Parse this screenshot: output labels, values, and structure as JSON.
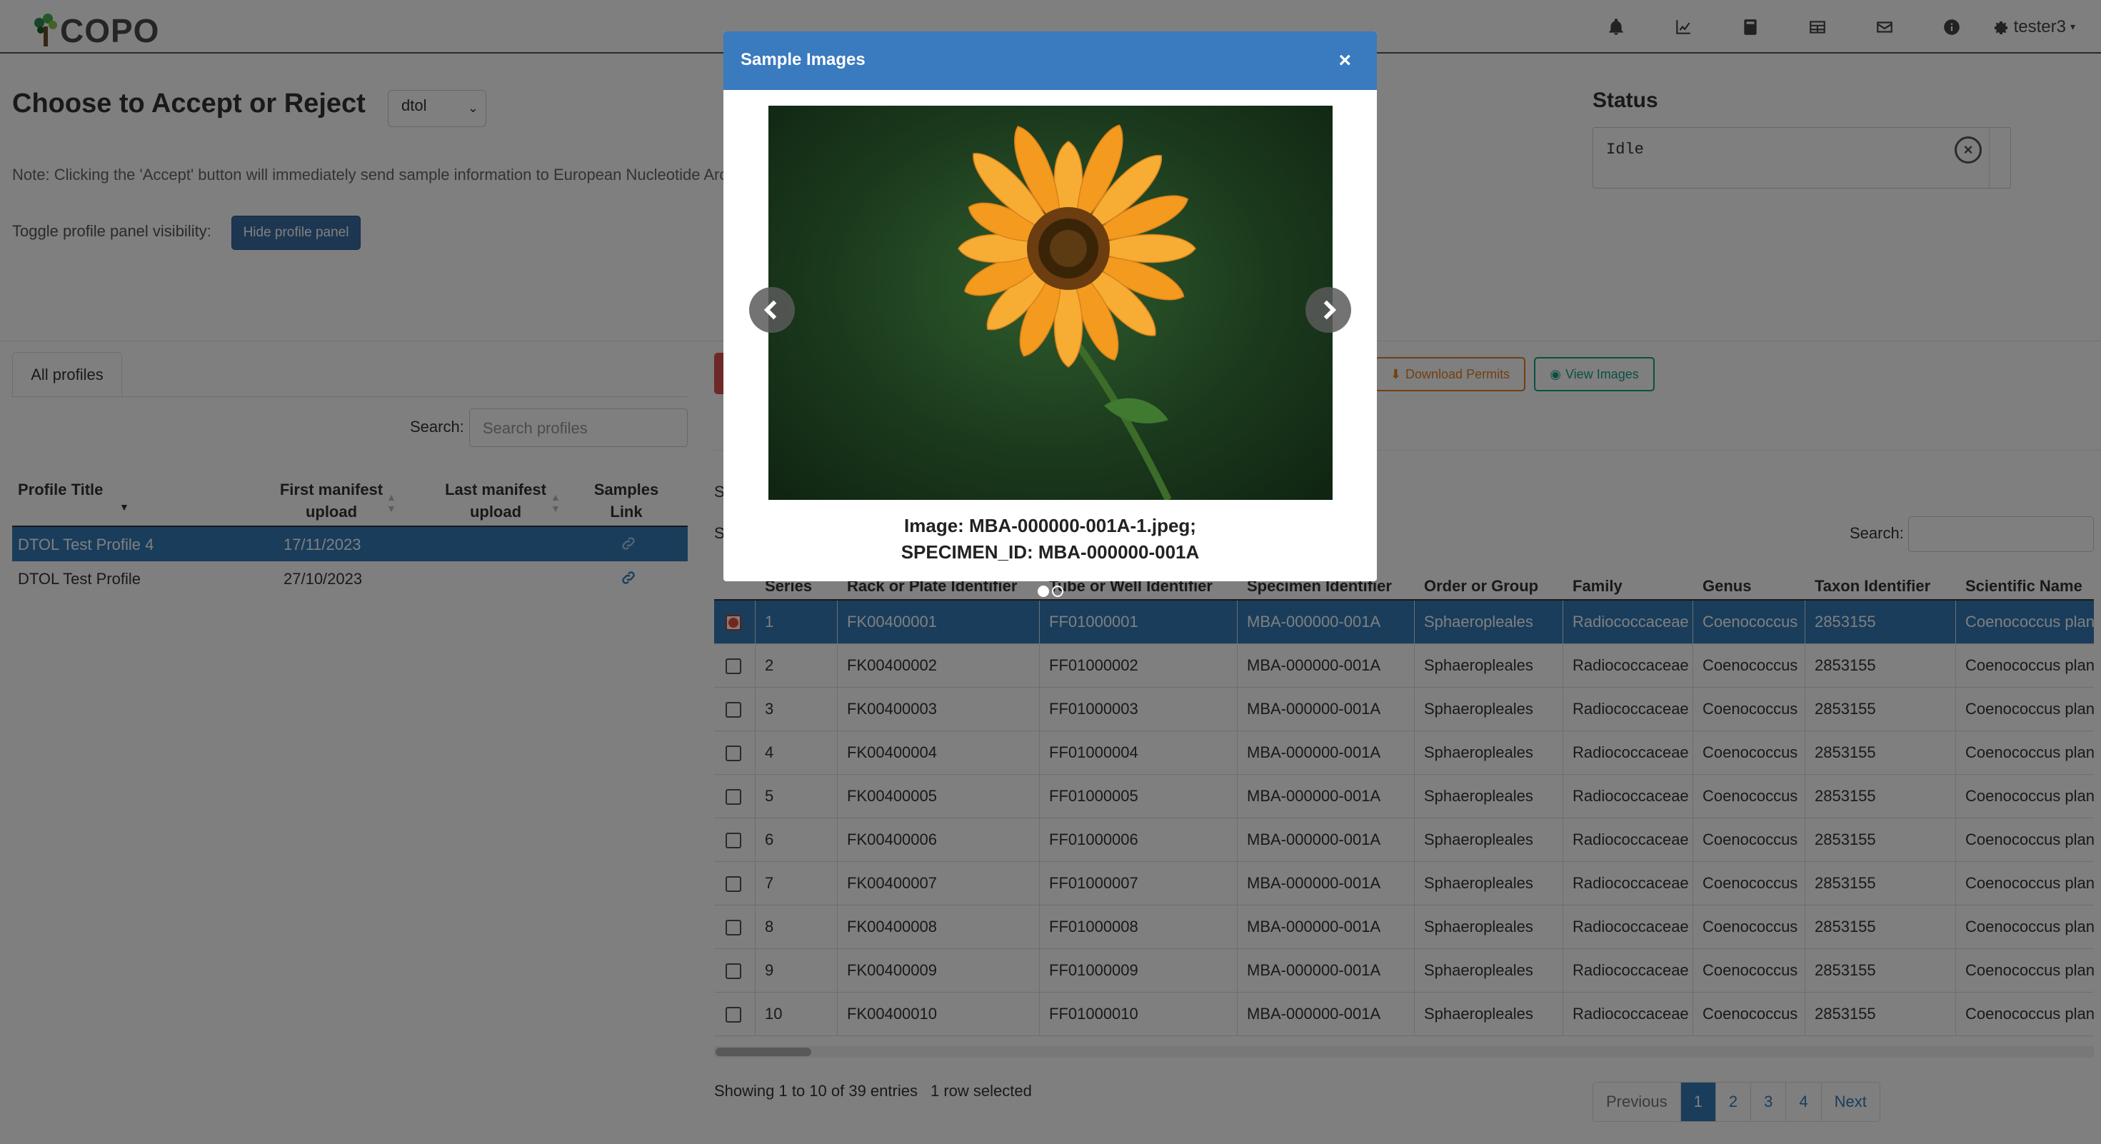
{
  "brand": {
    "logo_text": "COPO"
  },
  "navbar": {
    "icons": [
      "bell-icon",
      "chart-icon",
      "book-icon",
      "table-icon",
      "envelope-icon",
      "info-icon"
    ],
    "user": "tester3"
  },
  "header": {
    "title": "Choose to Accept or Reject",
    "profile_type": "dtol",
    "note": "Note: Clicking the 'Accept' button will immediately send sample information to European Nucleotide Archive (ENA)",
    "toggle_label": "Toggle profile panel visibility:",
    "hide_button": "Hide profile panel"
  },
  "status": {
    "title": "Status",
    "text": "Idle"
  },
  "profiles": {
    "tab": "All profiles",
    "search_label": "Search:",
    "search_placeholder": "Search profiles",
    "columns": [
      "Profile Title",
      "First manifest upload",
      "Last manifest upload",
      "Samples Link"
    ],
    "rows": [
      {
        "title": "DTOL Test Profile 4",
        "first": "17/11/2023",
        "last": "",
        "selected": true
      },
      {
        "title": "DTOL Test Profile",
        "first": "27/10/2023",
        "last": "",
        "selected": false
      }
    ]
  },
  "samples_toolbar": {
    "download_permits": "Download Permits",
    "view_images": "View Images",
    "search_label": "Search:",
    "stub1": "S",
    "stub2": "S"
  },
  "samples": {
    "columns": [
      "",
      "Series",
      "Rack or Plate Identifier",
      "Tube or Well Identifier",
      "Specimen Identifier",
      "Order or Group",
      "Family",
      "Genus",
      "Taxon Identifier",
      "Scientific Name"
    ],
    "rows": [
      [
        "1",
        "FK00400001",
        "FF01000001",
        "MBA-000000-001A",
        "Sphaeropleales",
        "Radiococcaceae",
        "Coenococcus",
        "2853155",
        "Coenococcus planctonicus"
      ],
      [
        "2",
        "FK00400002",
        "FF01000002",
        "MBA-000000-001A",
        "Sphaeropleales",
        "Radiococcaceae",
        "Coenococcus",
        "2853155",
        "Coenococcus planctonicus"
      ],
      [
        "3",
        "FK00400003",
        "FF01000003",
        "MBA-000000-001A",
        "Sphaeropleales",
        "Radiococcaceae",
        "Coenococcus",
        "2853155",
        "Coenococcus planctonicus"
      ],
      [
        "4",
        "FK00400004",
        "FF01000004",
        "MBA-000000-001A",
        "Sphaeropleales",
        "Radiococcaceae",
        "Coenococcus",
        "2853155",
        "Coenococcus planctonicus"
      ],
      [
        "5",
        "FK00400005",
        "FF01000005",
        "MBA-000000-001A",
        "Sphaeropleales",
        "Radiococcaceae",
        "Coenococcus",
        "2853155",
        "Coenococcus planctonicus"
      ],
      [
        "6",
        "FK00400006",
        "FF01000006",
        "MBA-000000-001A",
        "Sphaeropleales",
        "Radiococcaceae",
        "Coenococcus",
        "2853155",
        "Coenococcus planctonicus"
      ],
      [
        "7",
        "FK00400007",
        "FF01000007",
        "MBA-000000-001A",
        "Sphaeropleales",
        "Radiococcaceae",
        "Coenococcus",
        "2853155",
        "Coenococcus planctonicus"
      ],
      [
        "8",
        "FK00400008",
        "FF01000008",
        "MBA-000000-001A",
        "Sphaeropleales",
        "Radiococcaceae",
        "Coenococcus",
        "2853155",
        "Coenococcus planctonicus"
      ],
      [
        "9",
        "FK00400009",
        "FF01000009",
        "MBA-000000-001A",
        "Sphaeropleales",
        "Radiococcaceae",
        "Coenococcus",
        "2853155",
        "Coenococcus planctonicus"
      ],
      [
        "10",
        "FK00400010",
        "FF01000010",
        "MBA-000000-001A",
        "Sphaeropleales",
        "Radiococcaceae",
        "Coenococcus",
        "2853155",
        "Coenococcus planctonicus"
      ]
    ],
    "selected_rows": [
      0
    ],
    "showing": "Showing 1 to 10 of 39 entries",
    "selected_count": "1 row selected",
    "pagination": {
      "previous": "Previous",
      "pages": [
        "1",
        "2",
        "3",
        "4"
      ],
      "active": "1",
      "next": "Next"
    }
  },
  "modal": {
    "title": "Sample Images",
    "close": "×",
    "caption_line1": "Image: MBA-000000-001A-1.jpeg;",
    "caption_line2": "SPECIMEN_ID: MBA-000000-001A",
    "slide_count": 2,
    "active_slide": 0
  },
  "colors": {
    "primary": "#337ab7",
    "modal_header": "#3a7abf",
    "download": "#e67e22",
    "view": "#16a085",
    "danger": "#d9534f"
  }
}
